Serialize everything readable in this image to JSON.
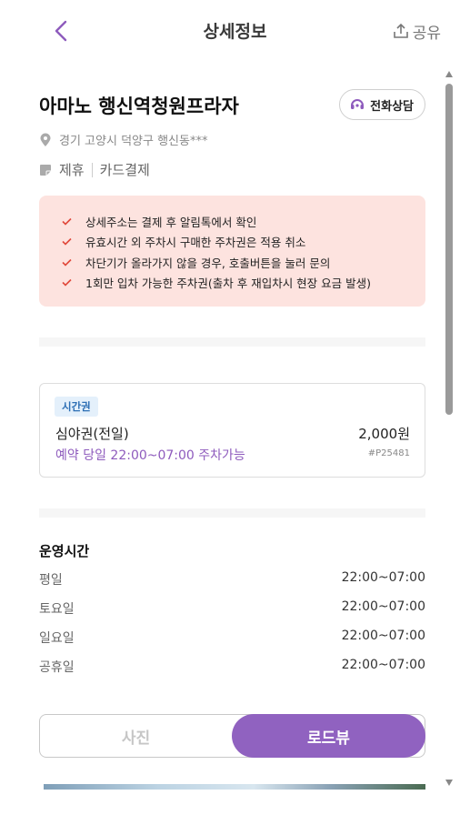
{
  "header": {
    "title": "상세정보",
    "share_label": "공유"
  },
  "place": {
    "name": "아마노 행신역청원프라자",
    "call_label": "전화상담",
    "address": "경기 고양시 덕양구 행신동***",
    "tags": [
      "제휴",
      "카드결제"
    ]
  },
  "notices": [
    "상세주소는 결제 후 알림톡에서 확인",
    "유효시간 외 주차시 구매한 주차권은 적용 취소",
    "차단기가 올라가지 않을 경우, 호출버튼을 눌러 문의",
    "1회만 입차 가능한 주차권(출차 후 재입차시 현장 요금 발생)"
  ],
  "ticket": {
    "badge": "시간권",
    "name": "심야권(전일)",
    "price": "2,000원",
    "note": "예약 당일 22:00~07:00 주차가능",
    "code": "#P25481"
  },
  "hours": {
    "title": "운영시간",
    "rows": [
      {
        "day": "평일",
        "time": "22:00~07:00"
      },
      {
        "day": "토요일",
        "time": "22:00~07:00"
      },
      {
        "day": "일요일",
        "time": "22:00~07:00"
      },
      {
        "day": "공휴일",
        "time": "22:00~07:00"
      }
    ]
  },
  "tabs": {
    "photo": "사진",
    "roadview": "로드뷰",
    "selected": "roadview"
  },
  "colors": {
    "accent": "#9062c0",
    "notice_bg": "#fde3df",
    "check": "#e0483a",
    "badge_bg": "#e4f0fb",
    "badge_text": "#2d6fb5"
  },
  "icons": {
    "back": "chevron-left-icon",
    "share": "share-upload-icon",
    "call": "headset-icon",
    "location": "map-pin-icon",
    "tag": "note-icon",
    "check": "check-icon"
  }
}
